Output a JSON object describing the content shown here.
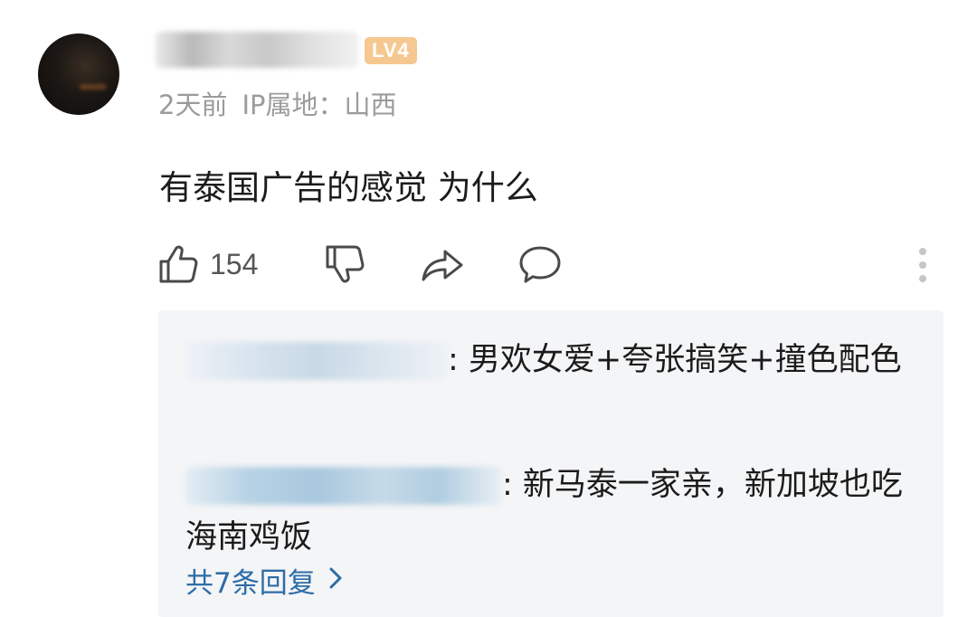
{
  "comment": {
    "level_badge": "LV4",
    "time_ago": "2天前",
    "ip_label": "IP属地：山西",
    "text": "有泰国广告的感觉 为什么",
    "like_count": "154"
  },
  "replies": [
    {
      "text": ": 男欢女爱+夸张搞笑+撞色配色"
    },
    {
      "text": ": 新马泰一家亲，新加坡也吃海南鸡饭"
    }
  ],
  "view_more_label": "共7条回复",
  "icons": {
    "like": "thumbs-up-icon",
    "dislike": "thumbs-down-icon",
    "share": "share-icon",
    "reply": "comment-bubble-icon",
    "more": "more-vertical-icon",
    "chevron": "chevron-right-icon"
  },
  "colors": {
    "link": "#2e6da6",
    "badge": "#f6c891",
    "meta_text": "#9b9b9b",
    "reply_bg": "#f4f5f7"
  }
}
